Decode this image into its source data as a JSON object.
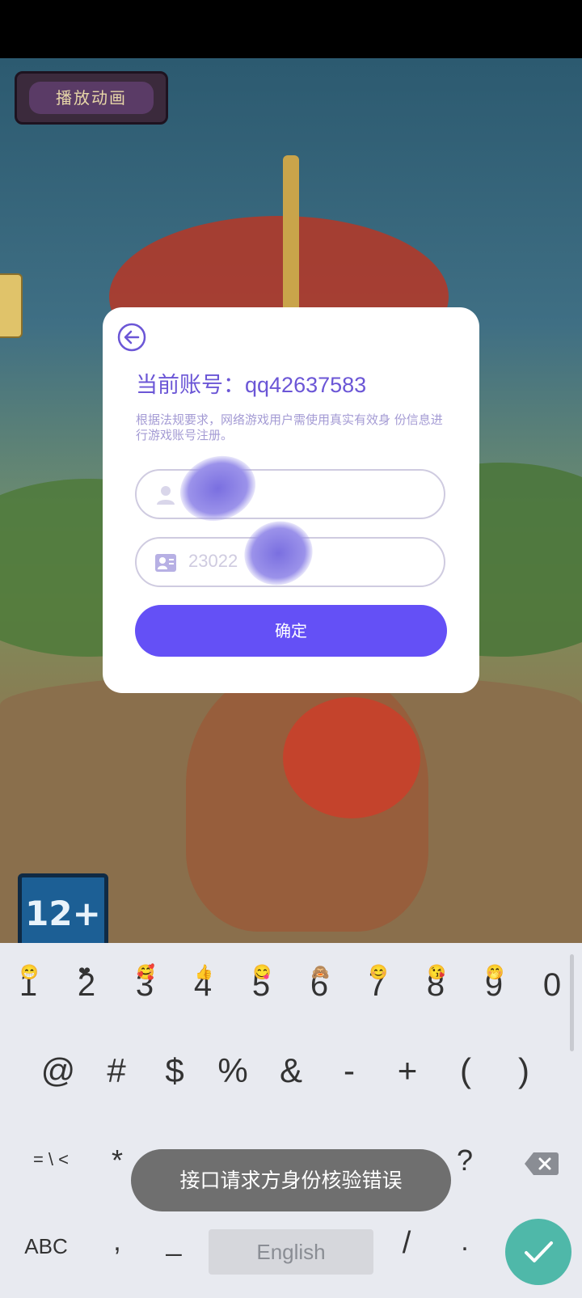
{
  "game": {
    "play_animation_label": "播放动画",
    "age_rating": "12+"
  },
  "dialog": {
    "account_line": "当前账号：qq42637583",
    "notice": "根据法规要求，网络游戏用户需使用真实有效身 份信息进行游戏账号注册。",
    "name_field_value": "",
    "id_field_value": "23022",
    "confirm_label": "确定"
  },
  "keyboard": {
    "numbers": [
      "1",
      "2",
      "3",
      "4",
      "5",
      "6",
      "7",
      "8",
      "9",
      "0"
    ],
    "number_emojis": [
      "😁",
      "❤",
      "🥰",
      "👍",
      "😋",
      "🙈",
      "😊",
      "😘",
      "🤭",
      ""
    ],
    "symbols": [
      "@",
      "#",
      "$",
      "%",
      "&",
      "-",
      "+",
      "(",
      ")"
    ],
    "row3_left": "= \\ <",
    "star": "*",
    "question": "?",
    "abc_label": "ABC",
    "comma": ",",
    "underscore": "_",
    "space_label": "English",
    "slash": "/",
    "dot": "."
  },
  "toast": {
    "message": "接口请求方身份核验错误"
  },
  "colors": {
    "accent": "#6450f6",
    "account_text": "#6b56d6",
    "done_key": "#4fb8a9"
  }
}
